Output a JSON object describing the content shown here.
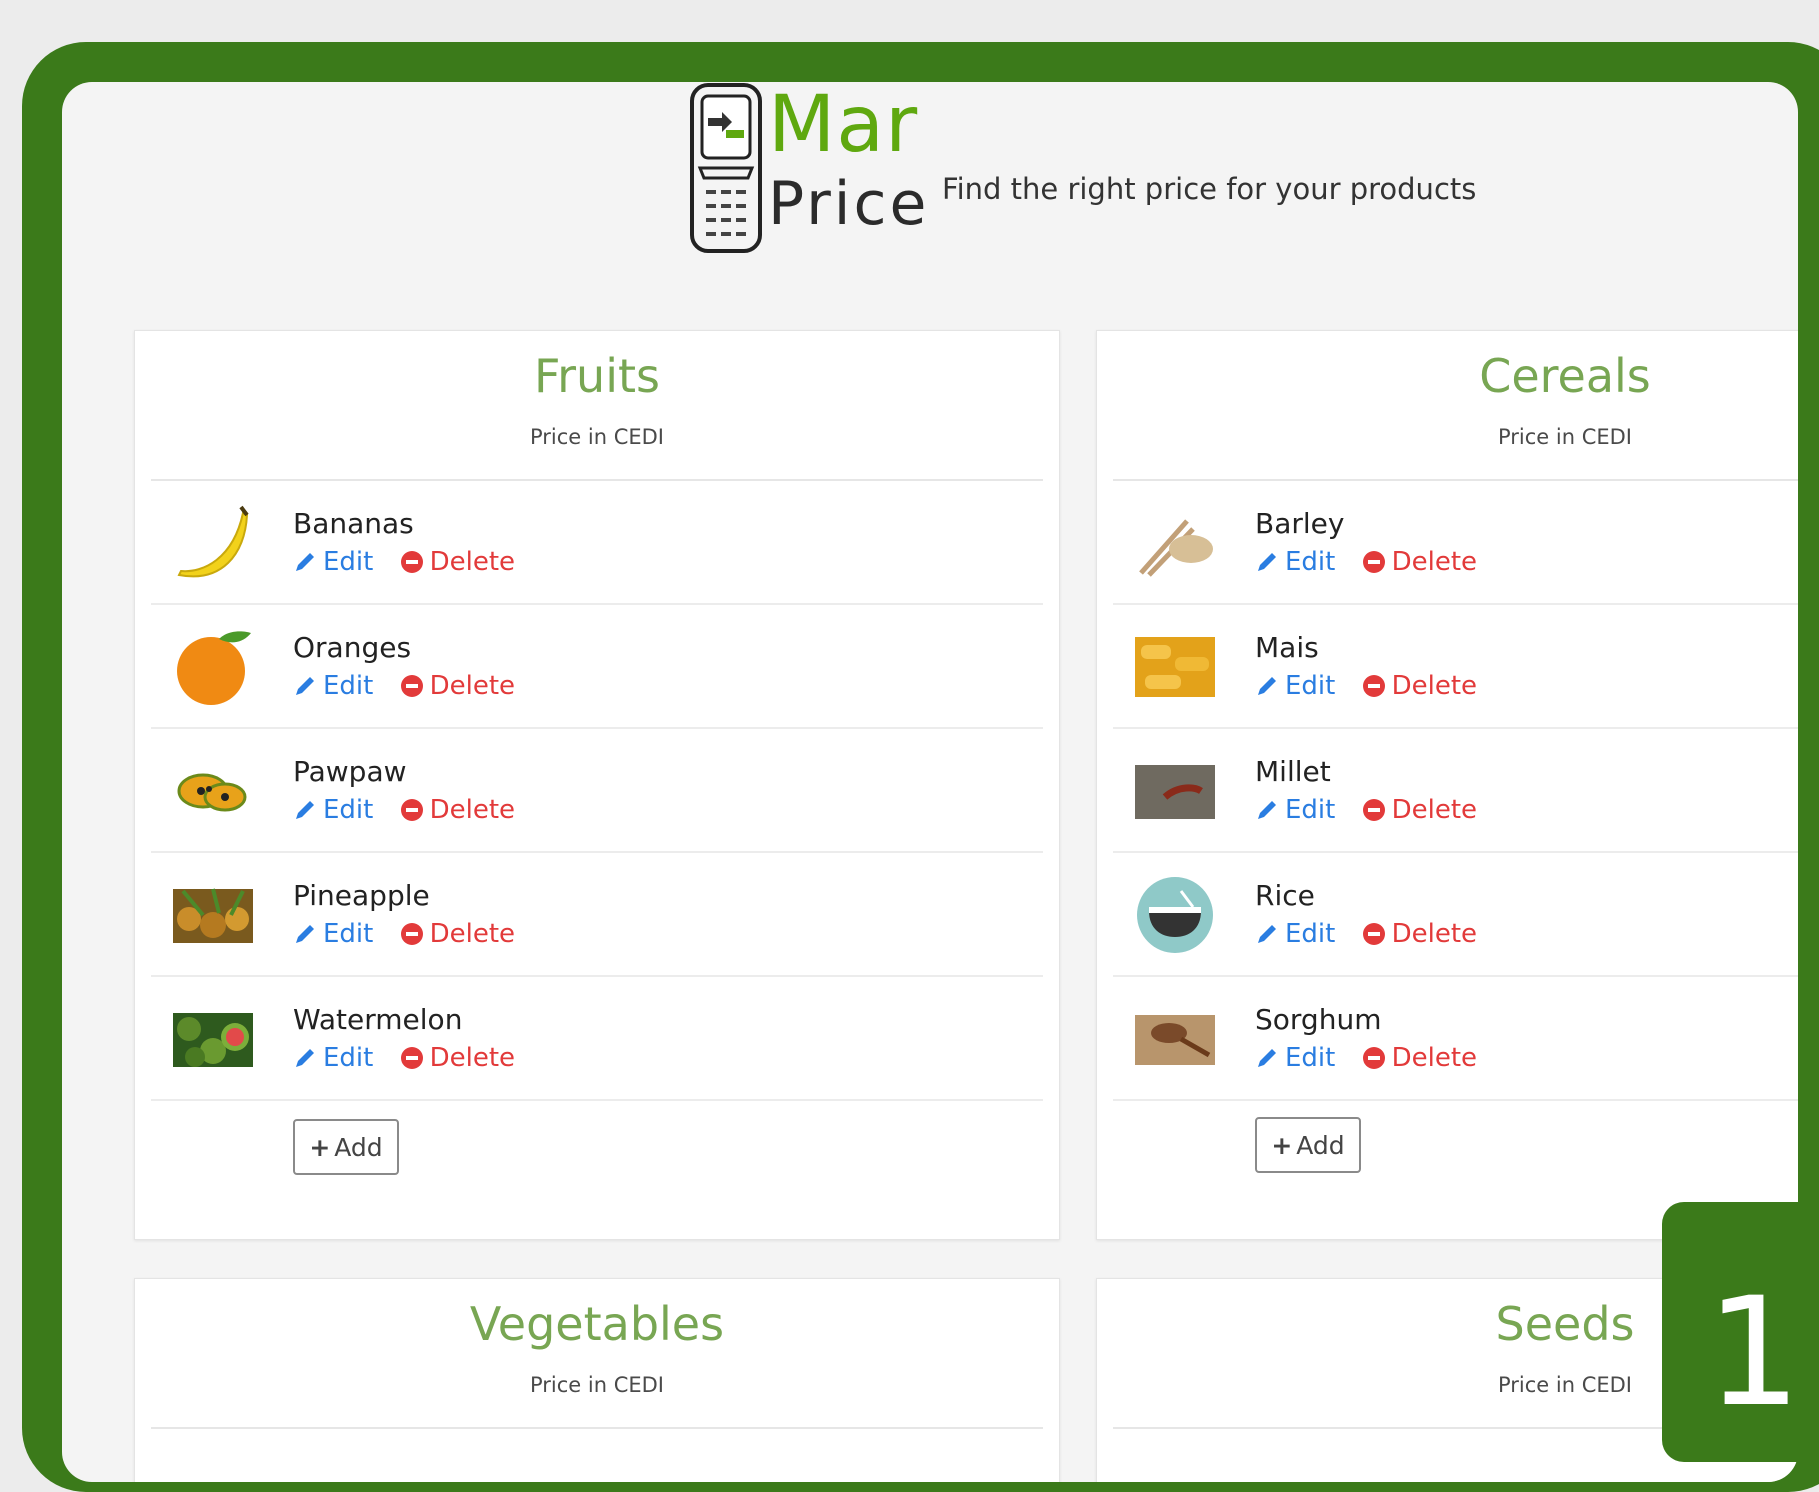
{
  "brand": {
    "logo_top": "Mar",
    "logo_bottom": "Price",
    "tagline": "Find the right price for your products"
  },
  "sections": [
    {
      "title": "Fruits",
      "subtitle": "Price in CEDI",
      "items": [
        {
          "name": "Bananas",
          "icon": "banana-icon"
        },
        {
          "name": "Oranges",
          "icon": "orange-icon"
        },
        {
          "name": "Pawpaw",
          "icon": "pawpaw-icon"
        },
        {
          "name": "Pineapple",
          "icon": "pineapple-icon"
        },
        {
          "name": "Watermelon",
          "icon": "watermelon-icon"
        }
      ],
      "add_label": "Add"
    },
    {
      "title": "Cereals",
      "subtitle": "Price in CEDI",
      "items": [
        {
          "name": "Barley",
          "icon": "barley-icon"
        },
        {
          "name": "Mais",
          "icon": "maize-icon"
        },
        {
          "name": "Millet",
          "icon": "millet-icon"
        },
        {
          "name": "Rice",
          "icon": "rice-bowl-icon"
        },
        {
          "name": "Sorghum",
          "icon": "sorghum-icon"
        }
      ],
      "add_label": "Add"
    },
    {
      "title": "Vegetables",
      "subtitle": "Price in CEDI"
    },
    {
      "title": "Seeds",
      "subtitle": "Price in CEDI"
    }
  ],
  "actions": {
    "edit_label": "Edit",
    "delete_label": "Delete"
  },
  "step_badge": "1",
  "colors": {
    "frame_green": "#3b7a1a",
    "brand_green": "#5fa80f",
    "title_green": "#78a653",
    "edit_blue": "#2a7de1",
    "delete_red": "#e23a3a"
  }
}
